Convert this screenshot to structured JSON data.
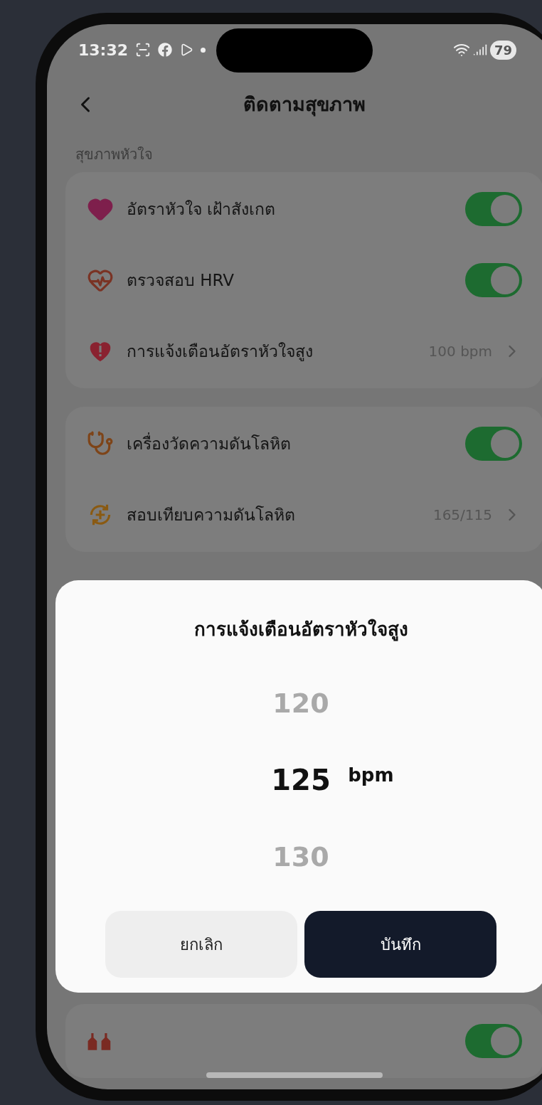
{
  "status_bar": {
    "time": "13:32",
    "battery": "79"
  },
  "header": {
    "title": "ติดตามสุขภาพ"
  },
  "sections": [
    {
      "title": "สุขภาพหัวใจ",
      "items": [
        {
          "kind": "toggle",
          "label": "อัตราหัวใจ เฝ้าสังเกต",
          "on": true
        },
        {
          "kind": "toggle",
          "label": "ตรวจสอบ HRV",
          "on": true
        },
        {
          "kind": "link",
          "label": "การแจ้งเตือนอัตราหัวใจสูง",
          "value": "100 bpm"
        }
      ]
    },
    {
      "items": [
        {
          "kind": "toggle",
          "label": "เครื่องวัดความดันโลหิต",
          "on": true
        },
        {
          "kind": "link",
          "label": "สอบเทียบความดันโลหิต",
          "value": "165/115"
        }
      ]
    },
    {
      "items": [
        {
          "kind": "toggle",
          "on": true
        }
      ]
    }
  ],
  "sheet": {
    "title": "การแจ้งเตือนอัตราหัวใจสูง",
    "unit": "bpm",
    "options": [
      {
        "value": "120",
        "selected": false
      },
      {
        "value": "125",
        "selected": true
      },
      {
        "value": "130",
        "selected": false
      }
    ],
    "buttons": [
      {
        "label": "ยกเลิก",
        "kind": "secondary"
      },
      {
        "label": "บันทึก",
        "kind": "primary"
      }
    ]
  }
}
